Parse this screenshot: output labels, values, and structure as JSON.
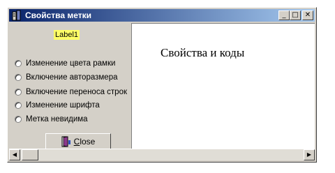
{
  "window": {
    "title": "Свойства метки",
    "buttons": {
      "minimize": "_",
      "maximize": "□",
      "close": "✕"
    }
  },
  "left": {
    "label1": "Label1",
    "options": [
      {
        "label": "Изменение цвета рамки"
      },
      {
        "label": "Включение авторазмера"
      },
      {
        "label": "Включение переноса строк"
      },
      {
        "label": "Изменение шрифта"
      },
      {
        "label": "Метка невидима"
      }
    ],
    "close_button": {
      "prefix": "",
      "underlined": "C",
      "rest": "lose"
    }
  },
  "right": {
    "title": "Свойства и коды"
  },
  "scrollbar": {
    "left_arrow": "◀",
    "right_arrow": "▶"
  },
  "colors": {
    "titlebar_start": "#0a246a",
    "titlebar_end": "#a6caf0",
    "label_bg": "#ffff66"
  }
}
